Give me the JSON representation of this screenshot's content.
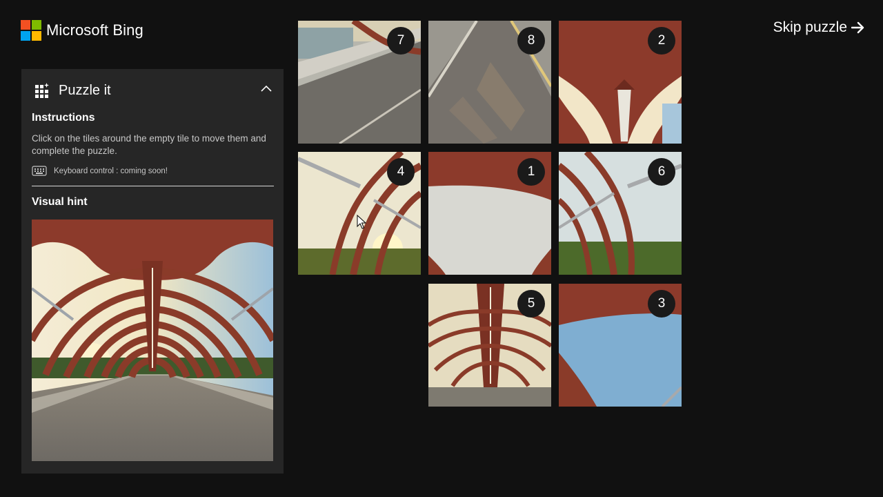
{
  "brand": {
    "name": "Microsoft Bing",
    "logo_colors": [
      "#f25022",
      "#7fba00",
      "#00a4ef",
      "#ffb900"
    ]
  },
  "header": {
    "skip_label": "Skip puzzle"
  },
  "panel": {
    "title": "Puzzle it",
    "instructions_title": "Instructions",
    "instructions_text": "Click on the tiles around the empty tile to move them and complete the puzzle.",
    "keyboard_note": "Keyboard control : coming soon!",
    "hint_title": "Visual hint"
  },
  "board": {
    "tiles": [
      {
        "label": "7"
      },
      {
        "label": "8"
      },
      {
        "label": "2"
      },
      {
        "label": "4"
      },
      {
        "label": "1"
      },
      {
        "label": "6"
      },
      {
        "label": "5"
      },
      {
        "label": "3"
      }
    ]
  },
  "colors": {
    "background": "#111111",
    "panel": "#262626",
    "accent_red": "#8c3a2b",
    "sky": "#b8d3e6"
  }
}
